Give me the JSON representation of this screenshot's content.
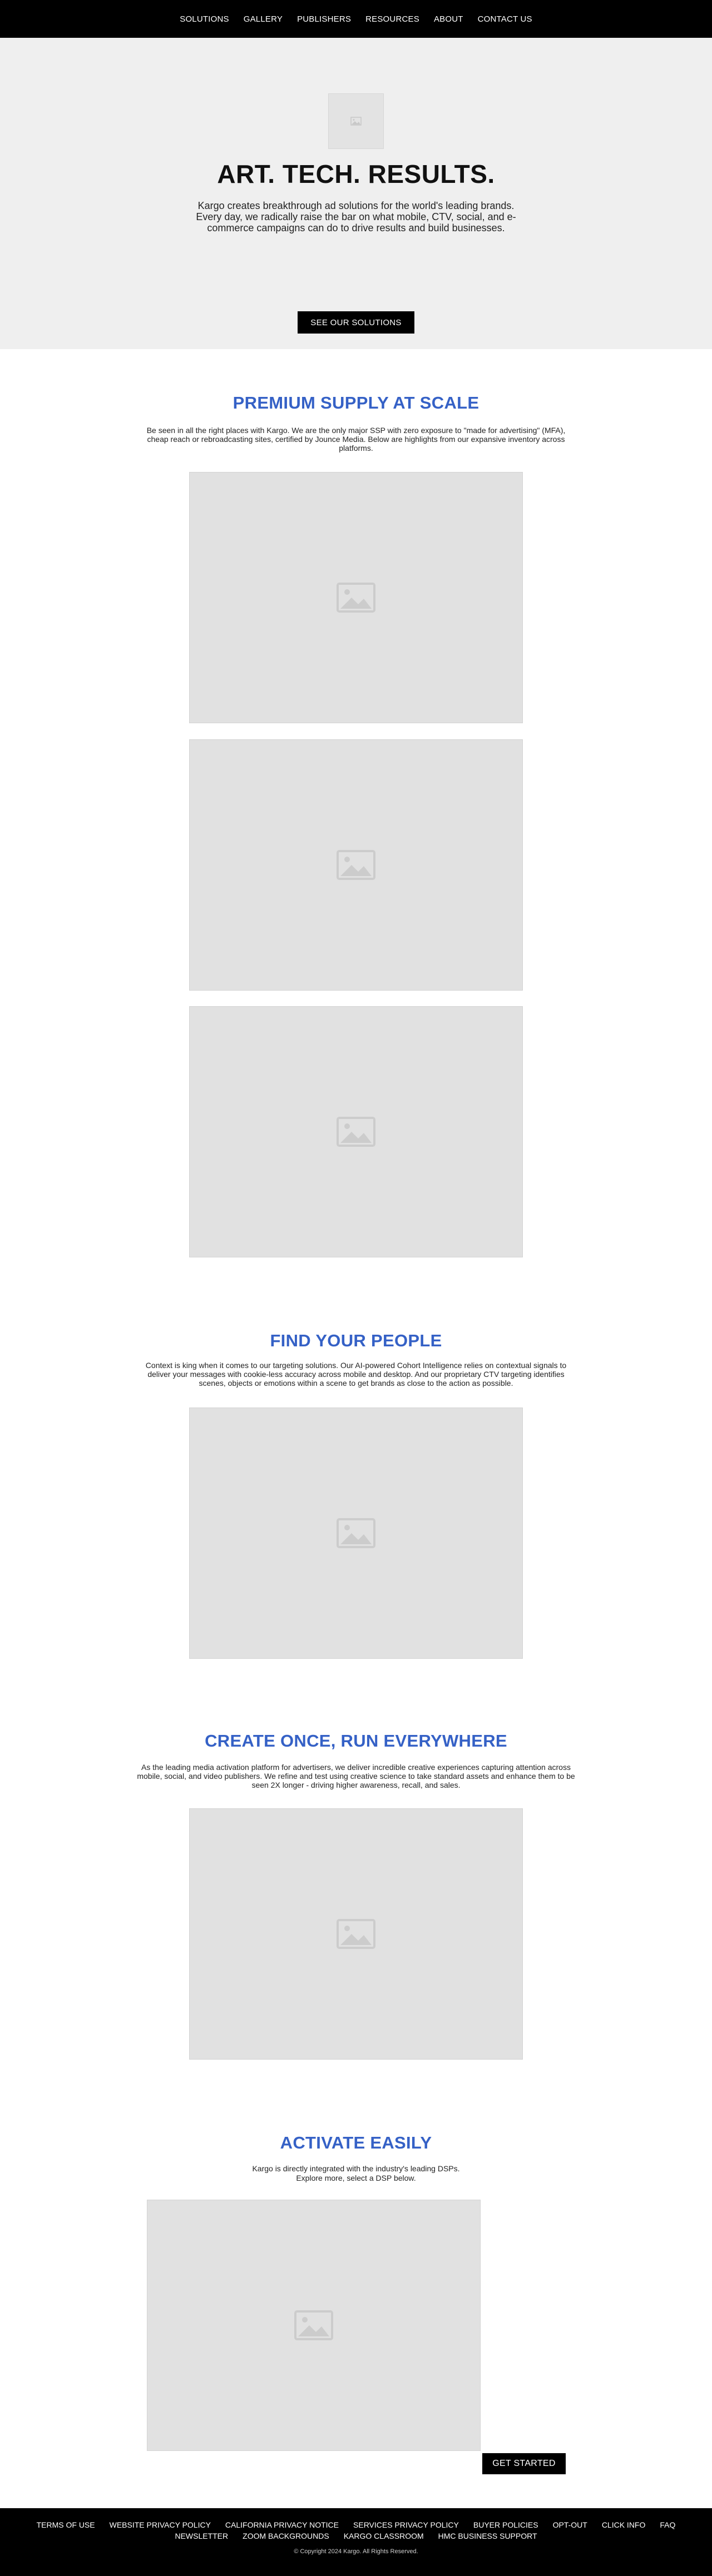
{
  "nav": {
    "items": [
      {
        "label": "SOLUTIONS"
      },
      {
        "label": "GALLERY"
      },
      {
        "label": "PUBLISHERS"
      },
      {
        "label": "RESOURCES"
      },
      {
        "label": "ABOUT"
      },
      {
        "label": "CONTACT US"
      }
    ]
  },
  "hero": {
    "logo_icon": "image-placeholder-icon",
    "title": "ART. TECH. RESULTS.",
    "description": "Kargo creates breakthrough ad solutions for the world's leading brands. Every day, we radically raise the bar on what mobile, CTV, social, and e-commerce campaigns can do to drive results and build businesses.",
    "button_label": "SEE OUR SOLUTIONS"
  },
  "sections": {
    "supply": {
      "title": "PREMIUM SUPPLY AT SCALE",
      "description": "Be seen in all the right places with Kargo. We are the only major SSP with zero exposure to \"made for advertising\" (MFA), cheap reach or rebroadcasting sites, certified by Jounce Media. Below are highlights from our expansive inventory across platforms."
    },
    "people": {
      "title": "FIND YOUR PEOPLE",
      "description": "Context is king when it comes to our targeting solutions. Our AI-powered Cohort Intelligence relies on contextual signals to deliver your messages with cookie-less accuracy across mobile and desktop. And our proprietary CTV targeting identifies scenes, objects or emotions within a scene to get brands as close to the action as possible."
    },
    "create": {
      "title": "CREATE ONCE, RUN EVERYWHERE",
      "description": "As the leading media activation platform for advertisers, we deliver incredible creative experiences capturing attention across mobile, social, and video publishers. We refine and test using creative science to take standard assets and enhance them to be seen 2X longer - driving higher awareness, recall, and sales."
    },
    "activate": {
      "title": "ACTIVATE EASILY",
      "description_line1": "Kargo is directly integrated with the industry's leading DSPs.",
      "description_line2": "Explore more, select a DSP below.",
      "button_label": "GET STARTED"
    }
  },
  "images": {
    "icon": "image-placeholder-icon"
  },
  "footer": {
    "links": [
      {
        "label": "TERMS OF USE"
      },
      {
        "label": "WEBSITE PRIVACY POLICY"
      },
      {
        "label": "CALIFORNIA PRIVACY NOTICE"
      },
      {
        "label": "SERVICES PRIVACY POLICY"
      },
      {
        "label": "BUYER POLICIES"
      },
      {
        "label": "OPT-OUT"
      },
      {
        "label": "CLICK INFO"
      },
      {
        "label": "FAQ"
      },
      {
        "label": "NEWSLETTER"
      },
      {
        "label": "ZOOM BACKGROUNDS"
      },
      {
        "label": "KARGO CLASSROOM"
      },
      {
        "label": "HMC BUSINESS SUPPORT"
      }
    ],
    "copyright": "© Copyright 2024 Kargo. All Rights Reserved."
  },
  "colors": {
    "nav_bg": "#000000",
    "hero_bg": "#efefef",
    "section_title": "#3561c6",
    "button_bg": "#000000",
    "placeholder_bg": "#e1e1e1"
  }
}
